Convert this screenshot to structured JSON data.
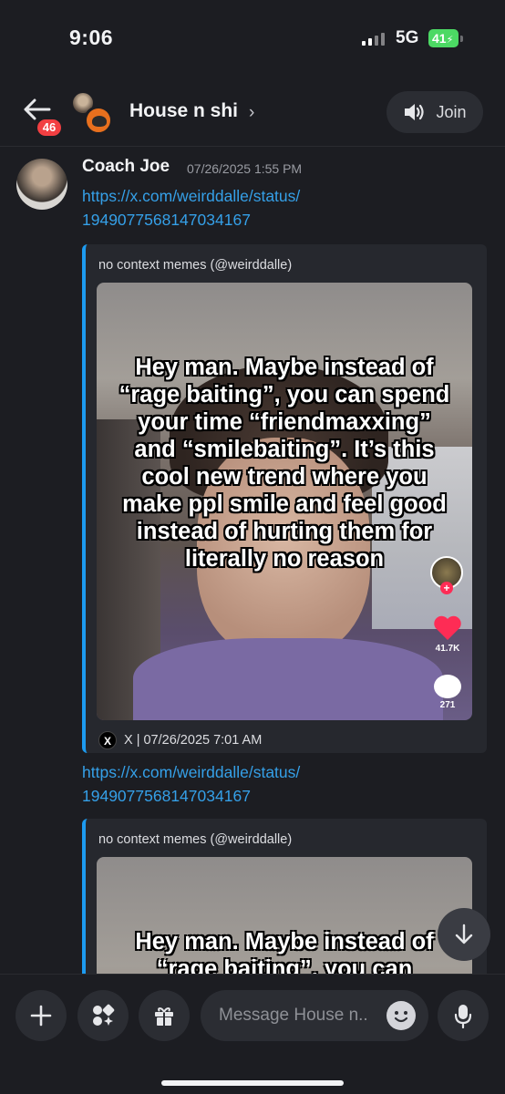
{
  "status_bar": {
    "time": "9:06",
    "network": "5G",
    "battery": "41"
  },
  "header": {
    "title": "House n shi",
    "unread_count": "46",
    "join_label": "Join"
  },
  "message": {
    "author": "Coach Joe",
    "timestamp": "07/26/2025 1:55 PM",
    "links": [
      {
        "line1": "https://x.com/weirddalle/status/",
        "line2": "1949077568147034167"
      },
      {
        "line1": "https://x.com/weirddalle/status/",
        "line2": "1949077568147034167"
      }
    ]
  },
  "embeds": [
    {
      "author": "no context memes (@weirddalle)",
      "overlay_text": "Hey man. Maybe instead of “rage baiting”, you can spend your time “friendmaxxing” and “smilebaiting”. It’s this cool new trend where you make ppl smile and feel good instead of hurting them for literally no reason",
      "like_count": "41.7K",
      "comment_count": "271",
      "footer": "X | 07/26/2025 7:01 AM"
    },
    {
      "author": "no context memes (@weirddalle)",
      "overlay_text": "Hey man. Maybe instead of “rage baiting”, you can"
    }
  ],
  "composer": {
    "placeholder": "Message House n.."
  },
  "colors": {
    "background": "#1c1d22",
    "link": "#35a0e8",
    "embed_accent": "#1d9bf0",
    "badge": "#f23f42"
  }
}
